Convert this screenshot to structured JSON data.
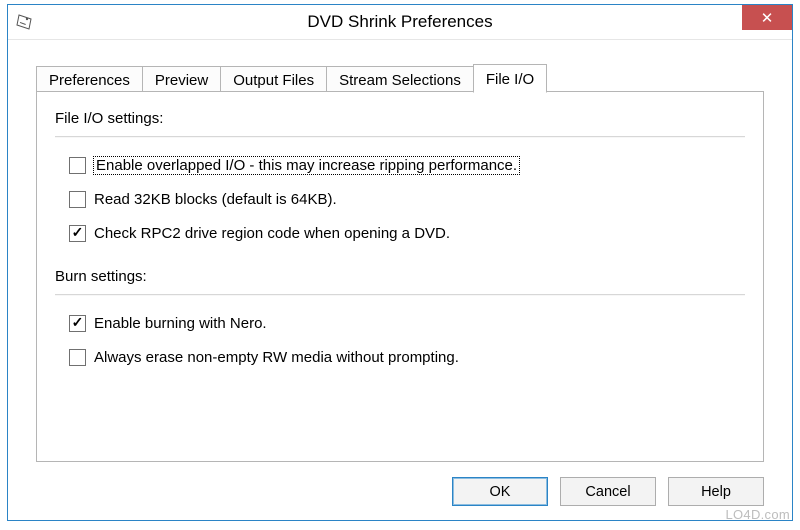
{
  "window": {
    "title": "DVD Shrink Preferences",
    "close_symbol": "✕"
  },
  "tabs": [
    {
      "label": "Preferences",
      "active": false
    },
    {
      "label": "Preview",
      "active": false
    },
    {
      "label": "Output Files",
      "active": false
    },
    {
      "label": "Stream Selections",
      "active": false
    },
    {
      "label": "File I/O",
      "active": true
    }
  ],
  "sections": {
    "file_io_heading": "File I/O settings:",
    "burn_heading": "Burn settings:"
  },
  "checkboxes": {
    "overlapped_io": {
      "label": "Enable overlapped I/O - this may increase ripping performance.",
      "checked": false,
      "focused": true
    },
    "read_32kb": {
      "label": "Read 32KB blocks (default is 64KB).",
      "checked": false,
      "focused": false
    },
    "check_rpc2": {
      "label": "Check RPC2 drive region code when opening a DVD.",
      "checked": true,
      "focused": false
    },
    "enable_nero": {
      "label": "Enable burning with Nero.",
      "checked": true,
      "focused": false
    },
    "always_erase": {
      "label": "Always erase non-empty RW media without prompting.",
      "checked": false,
      "focused": false
    }
  },
  "buttons": {
    "ok": "OK",
    "cancel": "Cancel",
    "help": "Help"
  },
  "watermark": "LO4D.com"
}
